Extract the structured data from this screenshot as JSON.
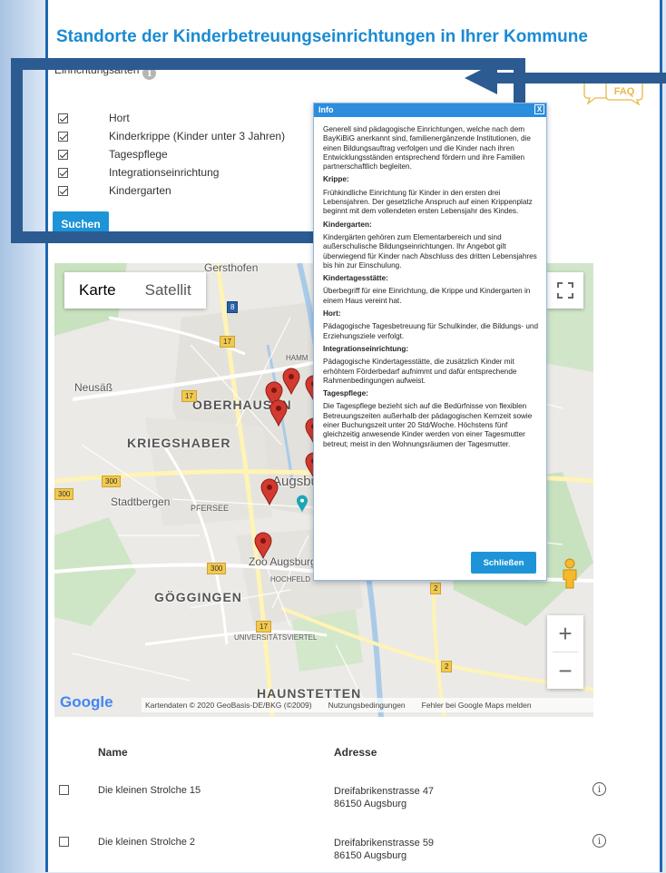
{
  "page": {
    "title": "Standorte der Kinderbetreuungseinrichtungen in Ihrer Kommune",
    "faq_label": "FAQ"
  },
  "filters": {
    "label": "Einrichtungsarten",
    "items": [
      {
        "label": "Hort",
        "checked": true
      },
      {
        "label": "Kinderkrippe (Kinder unter 3 Jahren)",
        "checked": true
      },
      {
        "label": "Tagespflege",
        "checked": true
      },
      {
        "label": "Integrationseinrichtung",
        "checked": true
      },
      {
        "label": "Kindergarten",
        "checked": true
      }
    ],
    "search_label": "Suchen"
  },
  "map": {
    "type_options": [
      "Karte",
      "Satellit"
    ],
    "active_type": "Karte",
    "places": {
      "gersthofen": "Gersthofen",
      "neusass": "Neusäß",
      "oberhausen": "OBERHAUSEN",
      "kriegshaber": "KRIEGSHABER",
      "augsburg": "Augsburg",
      "stadtbergen": "Stadtbergen",
      "pfersee": "PFERSEE",
      "zoo": "Zoo Augsburg",
      "hochfeld": "HOCHFELD",
      "goeggingen": "GÖGGINGEN",
      "universitaet": "UNIVERSITÄTSVIERTEL",
      "haunstetten": "HAUNSTETTEN",
      "hamm": "HAMM"
    },
    "road_numbers": [
      "8",
      "17",
      "17",
      "300",
      "300",
      "300",
      "17",
      "2",
      "2"
    ],
    "logo": "Google",
    "attribution": "Kartendaten © 2020 GeoBasis-DE/BKG (©2009)",
    "terms": "Nutzungsbedingungen",
    "report": "Fehler bei Google Maps melden",
    "zoom_in": "+",
    "zoom_out": "−",
    "marker_color": "#d33a2f"
  },
  "popup": {
    "title": "Info",
    "close_glyph": "X",
    "intro": "Generell sind pädagogische Einrichtungen, welche nach dem BayKiBiG anerkannt sind, familienergänzende Institutionen, die einen Bildungsauftrag verfolgen und die Kinder nach ihren Entwicklungsständen entsprechend fördern und ihre Familien partnerschaftlich begleiten.",
    "sections": [
      {
        "heading": "Krippe:",
        "text": "Frühkindliche Einrichtung für Kinder in den ersten drei Lebensjahren. Der gesetzliche Anspruch auf einen Krippenplatz beginnt mit dem vollendeten ersten Lebensjahr des Kindes."
      },
      {
        "heading": "Kindergarten:",
        "text": "Kindergärten gehören zum Elementarbereich und sind außerschulische Bildungseinrichtungen. Ihr Angebot gilt überwiegend für Kinder nach Abschluss des dritten Lebensjahres bis hin zur Einschulung."
      },
      {
        "heading": "Kindertagesstätte:",
        "text": "Überbegriff für eine Einrichtung, die Krippe und Kindergarten in einem Haus vereint hat."
      },
      {
        "heading": "Hort:",
        "text": "Pädagogische Tagesbetreuung für Schulkinder, die Bildungs- und Erziehungsziele verfolgt."
      },
      {
        "heading": "Integrationseinrichtung:",
        "text": "Pädagogische Kindertagesstätte, die zusätzlich Kinder mit erhöhtem Förderbedarf aufnimmt und dafür entsprechende Rahmenbedingungen aufweist."
      },
      {
        "heading": "Tagespflege:",
        "text": "Die Tagespflege bezieht sich auf die Bedürfnisse von flexiblen Betreuungszeiten außerhalb der pädagogischen Kernzeit sowie einer Buchungszeit unter 20 Std/Woche. Höchstens fünf gleichzeitig anwesende Kinder werden von einer Tagesmutter betreut; meist in den Wohnungsräumen der Tagesmutter."
      }
    ],
    "close_label": "Schließen"
  },
  "results": {
    "headers": {
      "name": "Name",
      "address": "Adresse"
    },
    "rows": [
      {
        "name": "Die kleinen Strolche 15",
        "street": "Dreifabrikenstrasse 47",
        "city": "86150 Augsburg"
      },
      {
        "name": "Die kleinen Strolche 2",
        "street": "Dreifabrikenstrasse 59",
        "city": "86150 Augsburg"
      }
    ]
  },
  "colors": {
    "accent": "#1a8bd3",
    "button": "#1d94d8",
    "highlight_frame": "#2c5b91"
  }
}
